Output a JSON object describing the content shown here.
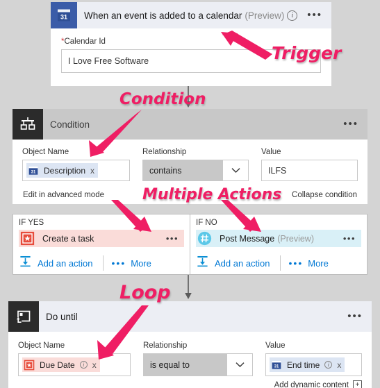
{
  "trigger": {
    "icon": "calendar-31-icon",
    "title": "When an event is added to a calendar",
    "preview": "(Preview)",
    "info_icon": "info-icon",
    "menu_icon": "ellipsis-icon",
    "field_label": "Calendar Id",
    "required_mark": "*",
    "field_value": "I Love Free Software"
  },
  "condition": {
    "icon": "condition-branch-icon",
    "title": "Condition",
    "menu_icon": "ellipsis-icon",
    "object_name_label": "Object Name",
    "object_name_token": "Description",
    "object_name_token_icon": "calendar-31-icon",
    "token_remove_icon": "x",
    "relationship_label": "Relationship",
    "relationship_value": "contains",
    "relationship_caret": "chevron-down-icon",
    "value_label": "Value",
    "value_text": "ILFS",
    "advanced_link": "Edit in advanced mode",
    "collapse_link": "Collapse condition"
  },
  "branches": {
    "yes": {
      "label": "IF YES",
      "action_icon": "wunderlist-star-icon",
      "action_name": "Create a task",
      "action_menu_icon": "ellipsis-icon",
      "add_action": "Add an action",
      "add_action_icon": "add-action-icon",
      "more": "More",
      "more_icon": "ellipsis-icon"
    },
    "no": {
      "label": "IF NO",
      "action_icon": "slack-hash-icon",
      "action_name": "Post Message",
      "action_preview": "(Preview)",
      "action_menu_icon": "ellipsis-icon",
      "add_action": "Add an action",
      "add_action_icon": "add-action-icon",
      "more": "More",
      "more_icon": "ellipsis-icon"
    }
  },
  "do_until": {
    "icon": "loop-icon",
    "title": "Do until",
    "menu_icon": "ellipsis-icon",
    "object_name_label": "Object Name",
    "object_name_token": "Due Date",
    "object_name_token_icon": "wunderlist-star-icon",
    "object_name_info_icon": "info-icon",
    "object_name_remove_icon": "x",
    "relationship_label": "Relationship",
    "relationship_value": "is equal to",
    "relationship_caret": "chevron-down-icon",
    "value_label": "Value",
    "value_token": "End time",
    "value_token_icon": "calendar-31-icon",
    "value_info_icon": "info-icon",
    "value_remove_icon": "x",
    "add_dynamic_content": "Add dynamic content",
    "add_dynamic_content_icon": "plus-box-icon"
  },
  "annotations": {
    "trigger": "Trigger",
    "condition": "Condition",
    "multiple_actions": "Multiple Actions",
    "loop": "Loop"
  },
  "colors": {
    "annotation": "#ef1e64",
    "page_background": "#d4d4d4",
    "accent_link": "#0078d4",
    "calendar_blue": "#3b5ca8",
    "wunderlist_red": "#e74c3c",
    "slack_blue": "#5bc8e8"
  }
}
